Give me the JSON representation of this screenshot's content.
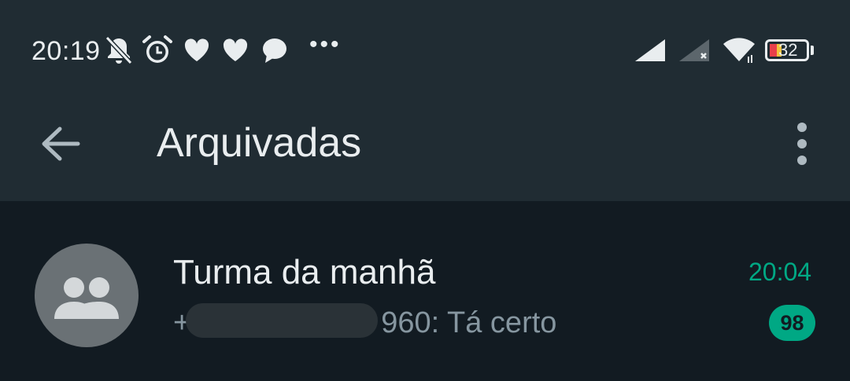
{
  "status_bar": {
    "time": "20:19",
    "left_icons": [
      "notifications-off-icon",
      "alarm-icon",
      "heart-icon",
      "heart-icon",
      "chat-bubble-icon"
    ],
    "more_indicator": "•••",
    "right_icons": [
      "signal-full-icon",
      "signal-empty-icon",
      "wifi-icon",
      "battery-icon"
    ],
    "battery_level": "32"
  },
  "app_bar": {
    "title": "Arquivadas",
    "back_icon": "arrow-back-icon",
    "menu_icon": "more-vert-icon"
  },
  "chats": [
    {
      "name": "Turma da manhã",
      "preview_prefix": "+",
      "preview_suffix": "960: Tá certo",
      "time": "20:04",
      "unread": "98",
      "avatar_icon": "group-icon"
    }
  ],
  "colors": {
    "header_bg": "#202c33",
    "body_bg": "#121b22",
    "accent": "#00a884",
    "text_primary": "#e9edef",
    "text_secondary": "#8696a0",
    "avatar_bg": "#6a7175"
  }
}
